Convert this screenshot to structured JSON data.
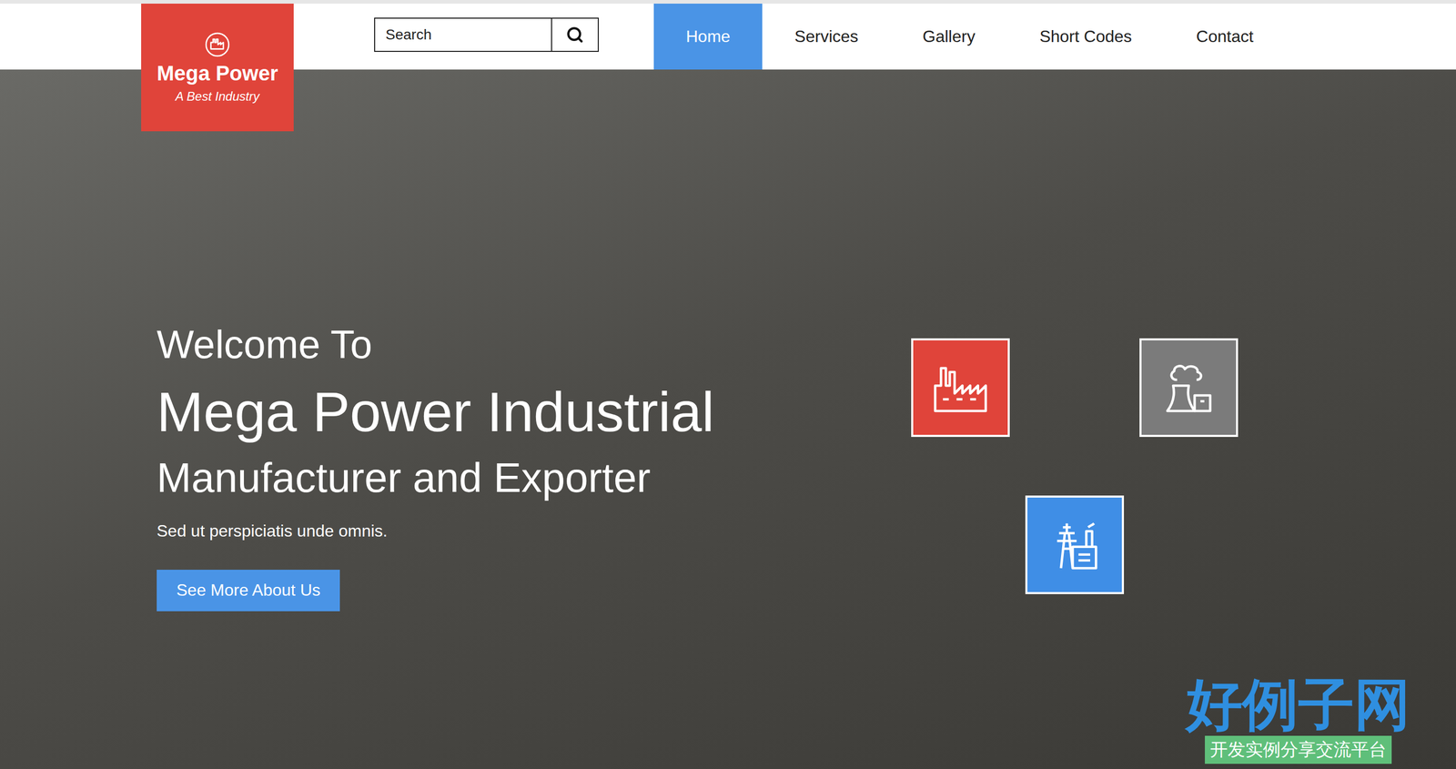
{
  "logo": {
    "title": "Mega Power",
    "tagline": "A Best Industry"
  },
  "search": {
    "placeholder": "Search"
  },
  "nav": [
    {
      "label": "Home",
      "selected": true
    },
    {
      "label": "Services",
      "selected": false
    },
    {
      "label": "Gallery",
      "selected": false
    },
    {
      "label": "Short Codes",
      "selected": false
    },
    {
      "label": "Contact",
      "selected": false
    }
  ],
  "hero": {
    "welcome": "Welcome To",
    "title": "Mega Power Industrial",
    "subtitle": "Manufacturer and Exporter",
    "text": "Sed ut perspiciatis unde omnis.",
    "button": "See More About Us"
  },
  "features": [
    {
      "kind": "factory",
      "color": "#e0443a"
    },
    {
      "kind": "plant",
      "color": "#7b7b7b"
    },
    {
      "kind": "refinery",
      "color": "#3f8ee6"
    }
  ],
  "watermark": {
    "title": "好例子网",
    "subtitle": "开发实例分享交流平台"
  }
}
